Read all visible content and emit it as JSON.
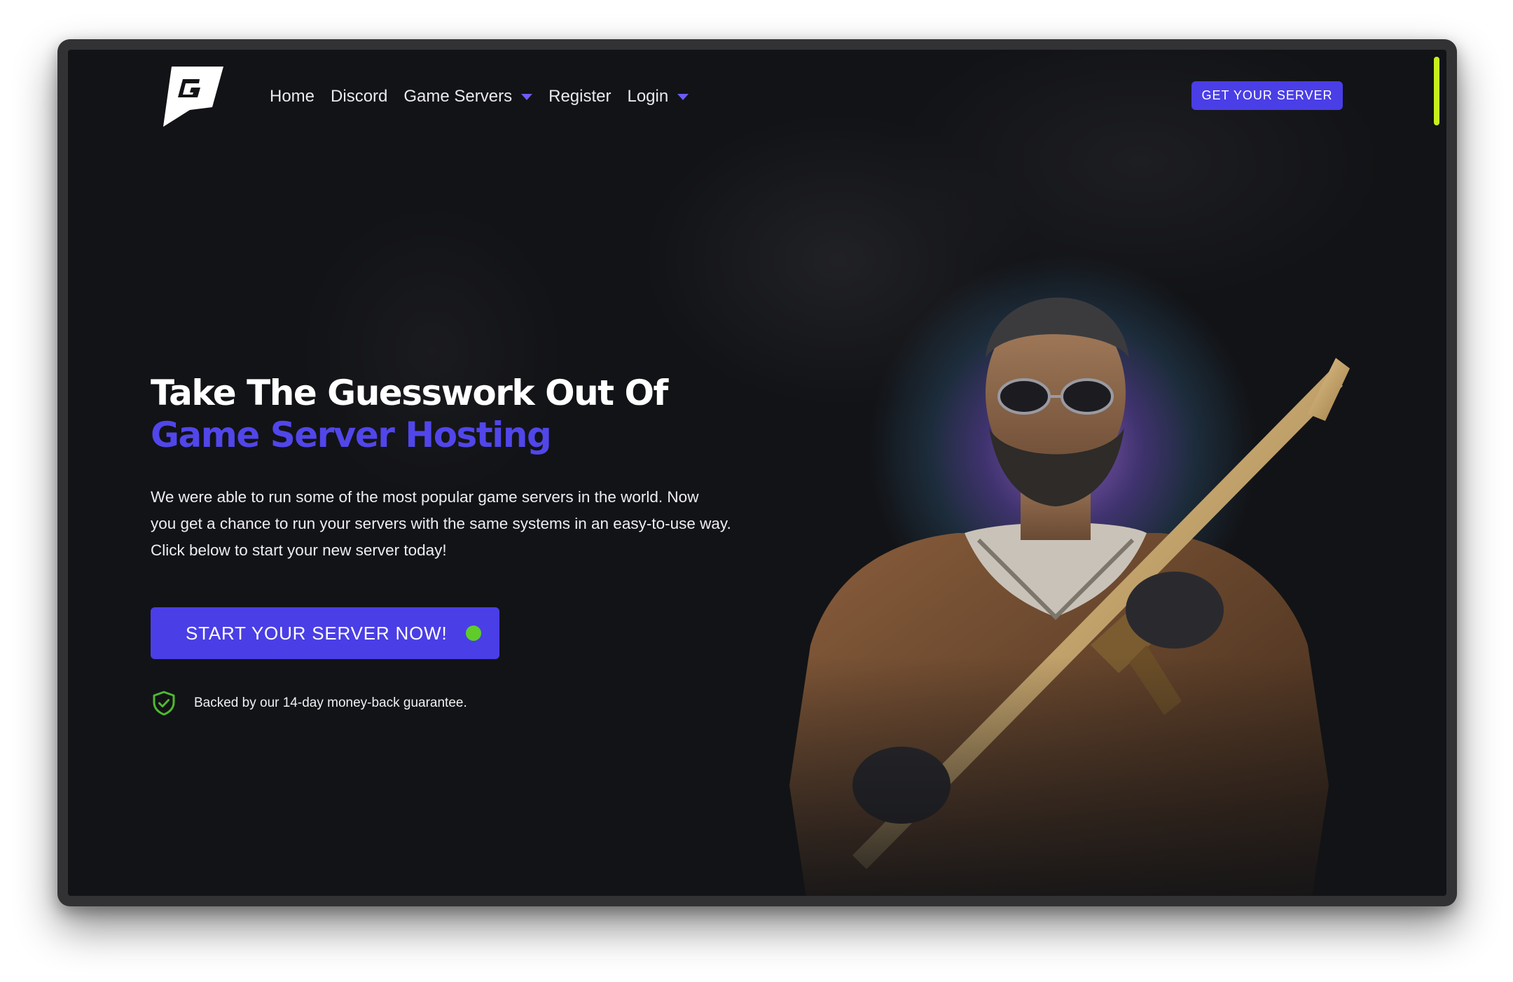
{
  "nav": {
    "logo_icon": "g-logo-icon",
    "items": [
      {
        "label": "Home",
        "has_dropdown": false
      },
      {
        "label": "Discord",
        "has_dropdown": false
      },
      {
        "label": "Game Servers",
        "has_dropdown": true
      },
      {
        "label": "Register",
        "has_dropdown": false
      },
      {
        "label": "Login",
        "has_dropdown": true
      }
    ],
    "cta_label": "GET YOUR SERVER"
  },
  "hero": {
    "title_line1": "Take The Guesswork Out Of",
    "title_line2": "Game Server Hosting",
    "description_lines": [
      "We were able to run some of the most popular game servers in the world. Now",
      "you get a chance to run your servers with the same systems in an easy-to-use way.",
      "Click below to start your new server today!"
    ],
    "cta_label": "START YOUR SERVER NOW!",
    "guarantee_text": "Backed by our 14-day money-back guarantee.",
    "guarantee_icon": "shield-check-icon",
    "image": "soldier-character-image"
  },
  "colors": {
    "background": "#121316",
    "accent": "#4a3ee6",
    "title_accent": "#5146ea",
    "status_green": "#5fcc2a",
    "scrollbar": "#c7ef1d"
  }
}
